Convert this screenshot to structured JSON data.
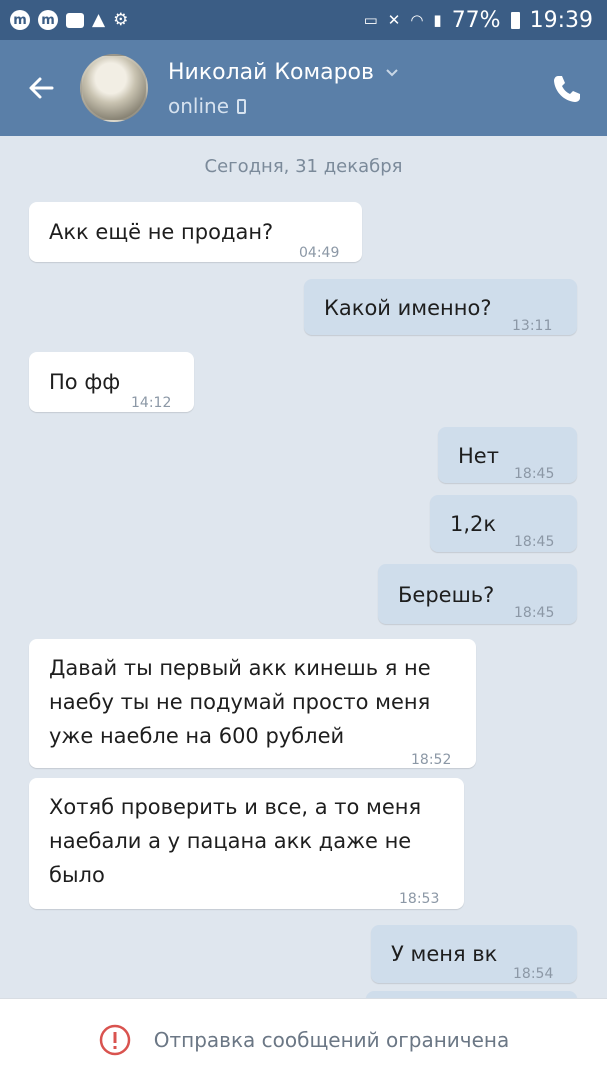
{
  "status_bar": {
    "left_icons": [
      "messenger-icon",
      "messenger-icon",
      "youtube-icon",
      "warning-icon",
      "settings-icon"
    ],
    "battery": "77%",
    "time": "19:39"
  },
  "header": {
    "contact_name": "Николай Комаров",
    "status": "online"
  },
  "chat": {
    "date": "Сегодня, 31 декабря",
    "messages": [
      {
        "direction": "in",
        "text": "Акк ещё не продан?",
        "time": "04:49"
      },
      {
        "direction": "out",
        "text": "Какой именно?",
        "time": "13:11"
      },
      {
        "direction": "in",
        "text": "По фф",
        "time": "14:12"
      },
      {
        "direction": "out",
        "text": "Нет",
        "time": "18:45"
      },
      {
        "direction": "out",
        "text": "1,2к",
        "time": "18:45"
      },
      {
        "direction": "out",
        "text": "Берешь?",
        "time": "18:45"
      },
      {
        "direction": "in",
        "text": "Давай ты первый акк кинешь я не наебу ты не подумай просто меня уже наебле на 600 рублей",
        "time": "18:52"
      },
      {
        "direction": "in",
        "text": "Хотяб проверить и все, а то меня наебали а у пацана акк даже не было",
        "time": "18:53"
      },
      {
        "direction": "out",
        "text": "У меня вк",
        "time": "18:54"
      }
    ]
  },
  "footer": {
    "restriction": "Отправка сообщений ограничена"
  },
  "colors": {
    "status_bar": "#3b5d85",
    "header": "#5a7fa8",
    "chat_bg": "#dfe6ee",
    "incoming": "#ffffff",
    "outgoing": "#cfddeb",
    "warning": "#d9534f"
  }
}
